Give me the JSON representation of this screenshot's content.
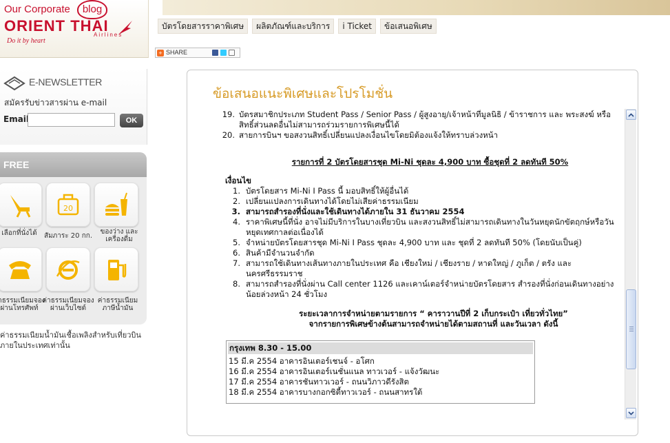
{
  "logo": {
    "corporate": "Our Corporate",
    "blog": "blog",
    "brand": "ORIENT THAI",
    "airlines": "Airlines",
    "tagline": "Do it by heart"
  },
  "nav": {
    "tabs": [
      "บัตรโดยสารราคาพิเศษ",
      "ผลิตภัณฑ์และบริการ",
      "i Ticket",
      "ข้อเสนอพิเศษ"
    ]
  },
  "share": {
    "label": "SHARE"
  },
  "newsletter": {
    "title": "E-NEWSLETTER",
    "subtitle": "สมัครรับข่าวสารผ่าน e-mail",
    "email_label": "Email",
    "email_value": "",
    "ok_label": "OK"
  },
  "free": {
    "header": "FREE",
    "tiles": [
      {
        "icon": "seat-icon",
        "label": "เลือกที่นั่งได้"
      },
      {
        "icon": "baggage-20kg-icon",
        "label": "สัมภาระ 20 กก."
      },
      {
        "icon": "food-drink-icon",
        "label": "ของว่าง และเครื่องดื่ม"
      },
      {
        "icon": "telephone-icon",
        "label": "ค่าธรรมเนียมจอง ผ่านโทรศัพท์"
      },
      {
        "icon": "internet-icon",
        "label": "ค่าธรรมเนียมจอง ผ่านเว็บไซต์"
      },
      {
        "icon": "fuel-pump-icon",
        "label": "ค่าธรรมเนียม ภาษีน้ำมัน"
      }
    ],
    "note": "ค่าธรรมเนียมน้ำมันเชื้อเพลิงสำหรับเที่ยวบินภายในประเทศเท่านั้น"
  },
  "content": {
    "heading": "ข้อเสนอแนะพิเศษและโปรโมชั่น",
    "list1": [
      {
        "num": "19.",
        "text": "บัตรสมาชิกประเภท Student Pass / Senior Pass / ผู้สูงอายุ/เจ้าหน้าที่มูลนิธิ / ข้าราชการ และ พระสงฆ์ หรือสิทธิ์ส่วนลดอื่นไม่สามารถร่วมรายการพิเศษนี้ได้"
      },
      {
        "num": "20.",
        "text": "สายการบินฯ ขอสงวนสิทธิ์เปลี่ยนแปลงเงื่อนไขโดยมิต้องแจ้งให้ทราบล่วงหน้า"
      }
    ],
    "item2_title": "รายการที่ 2 บัตรโดยสารชุด Mi-Ni ชุดละ 4,900 บาท ซื้อชุดที่ 2 ลดทันที 50%",
    "conditions_title": "เงื่อนไข",
    "conditions": [
      {
        "num": "1.",
        "text": "บัตรโดยสาร Mi-Ni I Pass นี้ มอบสิทธิ์ให้ผู้อื่นได้"
      },
      {
        "num": "2.",
        "text": "เปลี่ยนแปลงการเดินทางได้โดยไม่เสียค่าธรรมเนียม"
      },
      {
        "num": "3.",
        "text": "สามารถสำรองที่นั่งและใช้เดินทางได้ภายใน 31 ธันวาคม 2554"
      },
      {
        "num": "4.",
        "text": "ราคาพิเศษนี้ที่นั่ง อาจไม่มีบริการในบางเที่ยวบิน และสงวนสิทธิ์ไม่สามารถเดินทางในวันหยุดนักขัตฤกษ์หรือวันหยุดเทศกาลต่อเนื่องได้"
      },
      {
        "num": "5.",
        "text": "จำหน่ายบัตรโดยสารชุด Mi-Ni I Pass ชุดละ 4,900 บาท และ ชุดที่ 2 ลดทันที 50% (โดยนับเป็นคู่)"
      },
      {
        "num": "6.",
        "text": "สินค้ามีจำนวนจำกัด"
      },
      {
        "num": "7.",
        "text": "สามารถใช้เดินทางเส้นทางภายในประเทศ คือ เชียงใหม่ / เชียงราย / หาดใหญ่ / ภูเก็ต / ตรัง และนครศรีธรรมราช"
      },
      {
        "num": "8.",
        "text": "สามารถสำรองที่นั่งผ่าน Call center 1126 และเคาน์เตอร์จำหน่ายบัตรโดยสาร สำรองที่นั่งก่อนเดินทางอย่างน้อยล่วงหน้า 24 ชั่วโมง"
      }
    ],
    "period_line1": "ระยะเวลาการจำหน่ายตามรายการ “ คาราวานปีที่ 2 เก็บกระเป๋า เที่ยวทั่วไทย”",
    "period_line2": "จากรายการพิเศษข้างต้นสามารถจำหน่ายได้ตามสถานที่ และวันเวลา ดังนี้",
    "schedule": {
      "header": "กรุงเทพ   8.30 - 15.00",
      "rows": [
        "15 มี.ค 2554  อาคารอินเตอร์เชนจ์ - อโศก",
        "16 มี.ค 2554  อาคารอินเตอร์เนชั่นแนล ทาวเวอร์ - แจ้งวัฒนะ",
        "17 มี.ค 2554  อาคารชันทาวเวอร์ - ถนนวิภาวดีรังสิต",
        "18 มี.ค 2554  อาคารบางกอกซิตี้ทาวเวอร์ - ถนนสาทรใต้"
      ]
    }
  },
  "colors": {
    "brand_red": "#c8102e",
    "heading_gold": "#d79b27"
  }
}
